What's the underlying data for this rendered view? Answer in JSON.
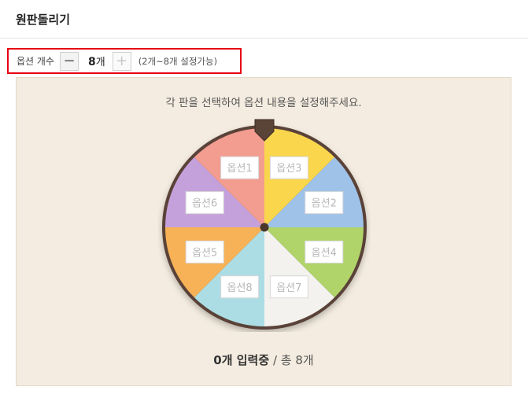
{
  "header": {
    "title": "원판돌리기"
  },
  "option_control": {
    "label": "옵션 개수",
    "minus_symbol": "−",
    "plus_symbol": "+",
    "count_value": "8",
    "count_unit": "개",
    "range_hint": "(2개~8개 설정가능)"
  },
  "panel": {
    "instruction": "각 판을 선택하여 옵션 내용을 설정해주세요.",
    "status_count": "0개 입력중",
    "status_sep": " / ",
    "status_total": "총 8개"
  },
  "wheel": {
    "segments": [
      {
        "label": "옵션3",
        "color": "#f9d64c"
      },
      {
        "label": "옵션2",
        "color": "#9ec2e8"
      },
      {
        "label": "옵션4",
        "color": "#b0d36a"
      },
      {
        "label": "옵션7",
        "color": "#f3f2ef"
      },
      {
        "label": "옵션8",
        "color": "#acdde4"
      },
      {
        "label": "옵션5",
        "color": "#f7b257"
      },
      {
        "label": "옵션6",
        "color": "#c5a1dc"
      },
      {
        "label": "옵션1",
        "color": "#f39c90"
      }
    ],
    "rim_color": "#5a4337",
    "pointer_color": "#5a4337"
  }
}
